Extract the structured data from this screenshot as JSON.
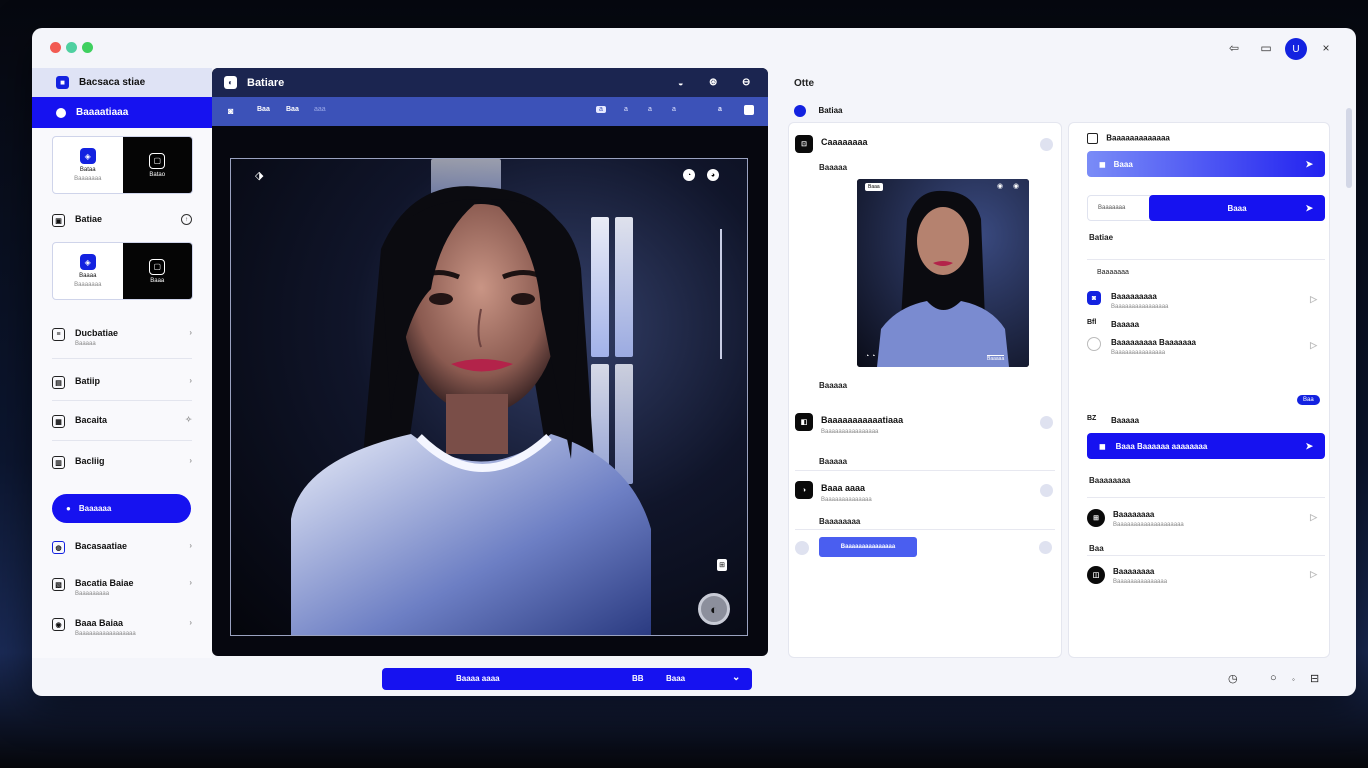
{
  "window": {
    "controls": [
      "back-icon",
      "window-icon",
      "user-avatar",
      "close-icon"
    ],
    "avatar_letter": "U",
    "close_glyph": "×"
  },
  "sidebar": {
    "header": "Bacsaca stiae",
    "selected": "Baaaatiaaa",
    "card1": {
      "left_label": "Bataa",
      "left_sub": "Baaaaaaa",
      "right_label": "Batao"
    },
    "profile": {
      "label": "Batiae"
    },
    "card2": {
      "left_label": "Baaaa",
      "left_sub": "Baaaaaaa",
      "right_label": "Baaa"
    },
    "items": [
      {
        "label": "Ducbatiae",
        "sub": "Baaaaa"
      },
      {
        "label": "Batiip",
        "sub": ""
      },
      {
        "label": "Bacaita",
        "sub": ""
      },
      {
        "label": "Bacliig",
        "sub": ""
      }
    ],
    "action_button": "Baaaaaa",
    "items2": [
      {
        "label": "Bacasaatiae",
        "sub": ""
      },
      {
        "label": "Bacatia Baiae",
        "sub": "Baaaaaaaaa"
      },
      {
        "label": "Baaa Baiaa",
        "sub": "Baaaaaaaaaaaaaaaaa"
      }
    ]
  },
  "editor": {
    "title": "Batiare",
    "toolbar": [
      "Baa",
      "Baa",
      "aaa",
      "a",
      "a",
      "a",
      "a",
      "a"
    ]
  },
  "midpanel": {
    "title": "Otte",
    "subtitle": "Batiaa",
    "row1": {
      "label": "Caaaaaaaa",
      "sub": ""
    },
    "preview_label": "Baaaaa",
    "preview_tag": "Baaa",
    "preview_caption": "Baaaaa",
    "row2": {
      "label": "Baaaaaaaaaaatiaaa",
      "sub": "Baaaaaaaaaaaaaaaa"
    },
    "label3": "Baaaaa",
    "row3": {
      "label": "Baaa aaaa",
      "sub": "Baaaaaaaaaaaaaa"
    },
    "label4": "Baaaaaaaa",
    "pill": "Baaaaaaaaaaaaaaa"
  },
  "rightpanel": {
    "header": "Baaaaaaaaaaaaa",
    "btn1": "Baaa",
    "btn2_pre": "Baaaaaaa",
    "btn2": "Baaa",
    "label_a": "Batiae",
    "label_b": "Baaaaaaa",
    "opt1": {
      "label": "Baaaaaaaaa",
      "sub": "Baaaaaaaaaaaaaaaa"
    },
    "opt2_tag": "Bfl",
    "opt2": {
      "label": "Baaaaa"
    },
    "opt3": {
      "label": "Baaaaaaaaa Baaaaaaa",
      "sub": "Baaaaaaaaaaaaaaa"
    },
    "small_badge": "Baa",
    "opt4_tag": "BZ",
    "opt4": {
      "label": "Baaaaa"
    },
    "btn3": "Baaa Baaaaaa aaaaaaaa",
    "label_c": "Baaaaaaaa",
    "row5": {
      "label": "Baaaaaaaa",
      "sub": "Baaaaaaaaaaaaaaaaaaaa"
    },
    "label_d": "Baa",
    "row6": {
      "label": "Baaaaaaaa",
      "sub": "Baaaaaaaaaaaaaaa"
    }
  },
  "bottom": {
    "left": "Baaaa aaaa",
    "mid": "BB",
    "right": "Baaa"
  },
  "colors": {
    "accent": "#1612f0",
    "dark_header": "#1b2550",
    "toolbar": "#3c52b8"
  }
}
